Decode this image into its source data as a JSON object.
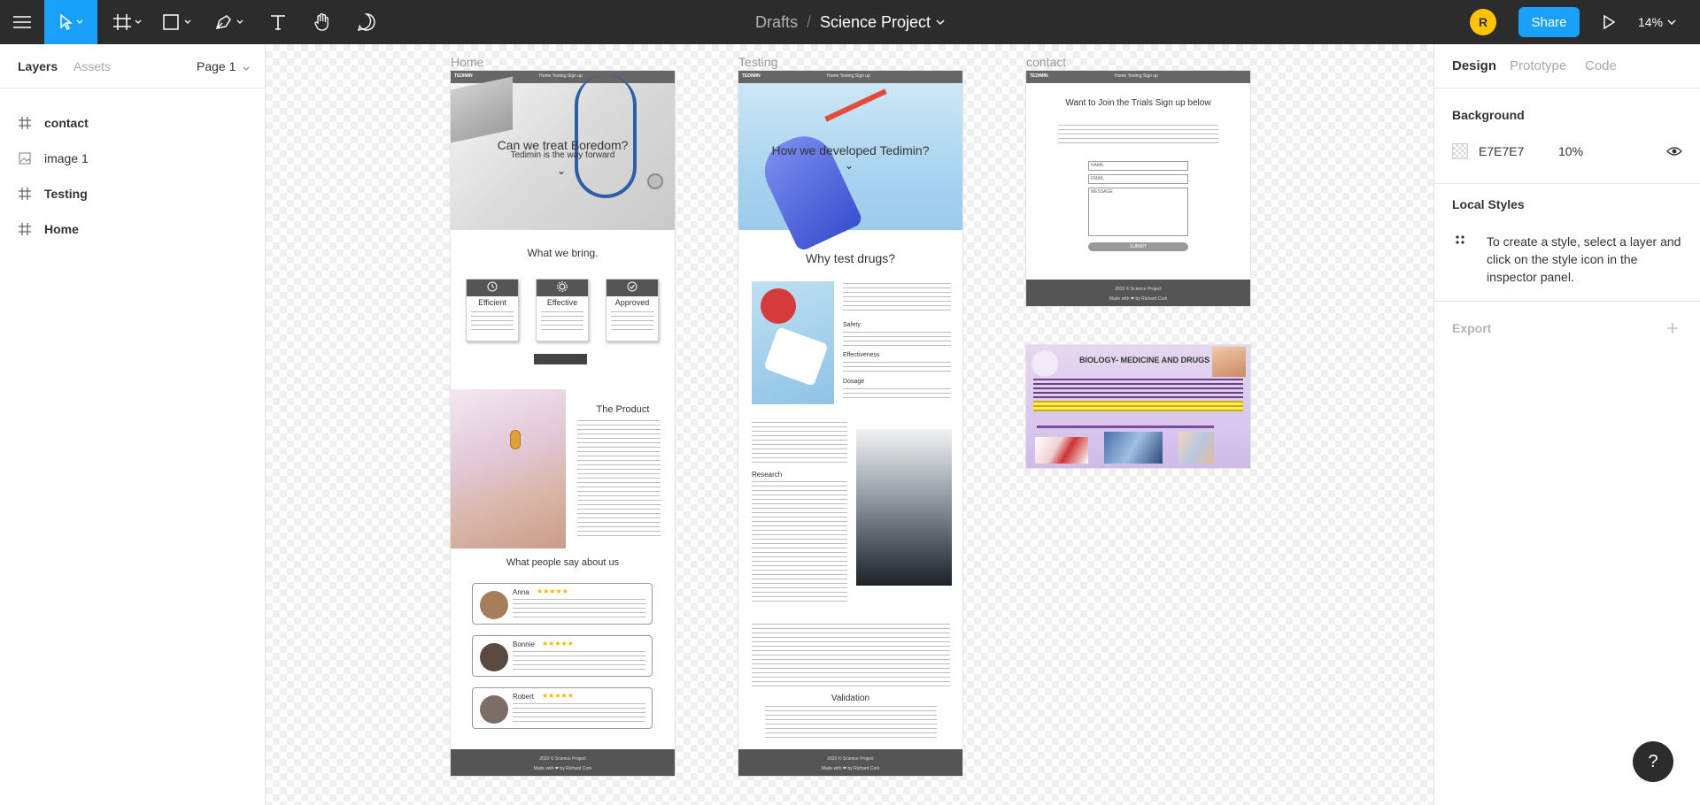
{
  "toolbar": {
    "menu_icon": "hamburger-icon",
    "tools": [
      "move-tool-icon",
      "frame-tool-icon",
      "shape-tool-icon",
      "pen-tool-icon",
      "text-tool-icon",
      "hand-tool-icon",
      "comment-tool-icon"
    ],
    "breadcrumb": {
      "drafts": "Drafts",
      "separator": "/",
      "title": "Science Project"
    },
    "avatar_initial": "R",
    "share_label": "Share",
    "zoom": "14%",
    "accent_color": "#18a0fb",
    "avatar_color": "#ffc400"
  },
  "left_panel": {
    "tabs": {
      "layers": "Layers",
      "assets": "Assets"
    },
    "page_selector": "Page 1",
    "layers": [
      {
        "label": "contact",
        "icon": "frame-icon"
      },
      {
        "label": "image 1",
        "icon": "image-icon"
      },
      {
        "label": "Testing",
        "icon": "frame-icon"
      },
      {
        "label": "Home",
        "icon": "frame-icon"
      }
    ]
  },
  "canvas": {
    "frames": {
      "home": {
        "label": "Home",
        "brand": "TEDIMIN",
        "nav_links": "Home    Testing    Sign up",
        "hero_title": "Can we treat Boredom?",
        "hero_subtitle": "Tedimin is the way forward",
        "section_title": "What we bring.",
        "features": [
          "Efficient",
          "Effective",
          "Approved"
        ],
        "product_title": "The Product",
        "reviews_title": "What people say about us",
        "reviews": [
          {
            "name": "Anna",
            "stars": "★★★★★"
          },
          {
            "name": "Bonnie",
            "stars": "★★★★★"
          },
          {
            "name": "Robert",
            "stars": "★★★★★"
          }
        ],
        "footer_line1": "2020 © Science Project",
        "footer_line2": "Made with ❤ by Richard Cork"
      },
      "testing": {
        "label": "Testing",
        "brand": "TEDIMIN",
        "nav_links": "Home    Testing    Sign up",
        "hero_title": "How we developed Tedimin?",
        "section_title": "Why test drugs?",
        "subheads": [
          "Safety",
          "Effectiveness",
          "Dosage"
        ],
        "research_title": "Research",
        "validation_title": "Validation",
        "footer_line1": "2020 © Science Project",
        "footer_line2": "Made with ❤ by Richard Cork"
      },
      "contact": {
        "label": "contact",
        "brand": "TEDIMIN",
        "nav_links": "Home    Testing    Sign up",
        "title": "Want to Join the Trials Sign up below",
        "fields": [
          "NAME",
          "EMAIL",
          "MESSAGE"
        ],
        "submit": "SUBMIT",
        "footer_line1": "2020 © Science Project",
        "footer_line2": "Made with ❤ by Richard Cork"
      },
      "image1": {
        "title": "BIOLOGY- MEDICINE AND DRUGS"
      }
    }
  },
  "right_panel": {
    "tabs": {
      "design": "Design",
      "prototype": "Prototype",
      "code": "Code"
    },
    "background_title": "Background",
    "background_hex": "E7E7E7",
    "background_opacity": "10%",
    "local_styles_title": "Local Styles",
    "local_styles_hint": "To create a style, select a layer and click on the style icon in the inspector panel.",
    "export_title": "Export"
  },
  "help_label": "?"
}
